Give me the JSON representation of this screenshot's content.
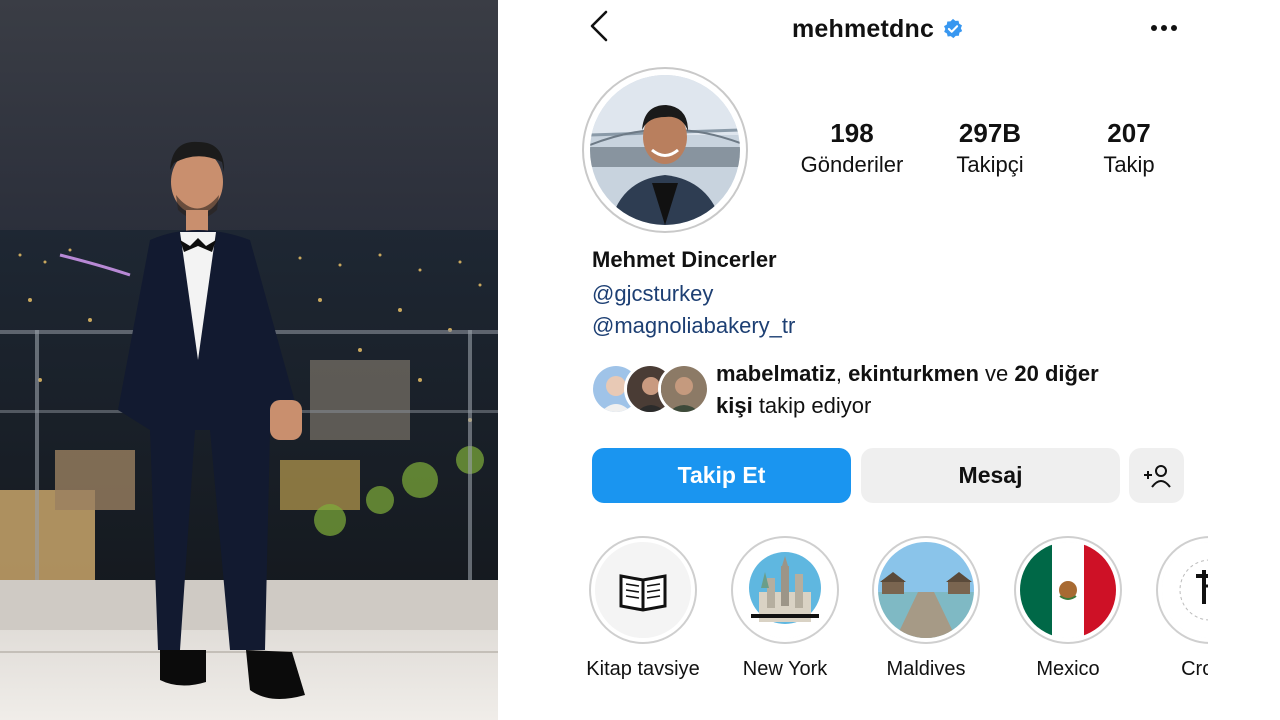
{
  "profile": {
    "username": "mehmetdnc",
    "full_name": "Mehmet Dincerler",
    "links": [
      "@gjcsturkey",
      "@magnoliabakery_tr"
    ],
    "stats": [
      {
        "value": "198",
        "label": "Gönderiler"
      },
      {
        "value": "297B",
        "label": "Takipçi"
      },
      {
        "value": "207",
        "label": "Takip"
      }
    ],
    "mutual": {
      "names": "mabelmatiz",
      "sep": ", ",
      "name2": "ekinturkmen",
      "and": " ve ",
      "others": "20 diğer",
      "others2": "kişi",
      "suffix": " takip ediyor"
    }
  },
  "buttons": {
    "follow": "Takip Et",
    "message": "Mesaj"
  },
  "highlights": [
    {
      "label": "Kitap tavsiye",
      "icon": "open-book-icon"
    },
    {
      "label": "New York",
      "icon": "new-york-skyline-icon"
    },
    {
      "label": "Maldives",
      "icon": "maldives-pier-icon"
    },
    {
      "label": "Mexico",
      "icon": "mexico-flag-icon"
    },
    {
      "label": "Crossf",
      "icon": "crossfit-icon"
    }
  ],
  "colors": {
    "follow_button": "#1a95f0",
    "link_text": "#1d3f73",
    "verified_badge": "#3897f0"
  }
}
